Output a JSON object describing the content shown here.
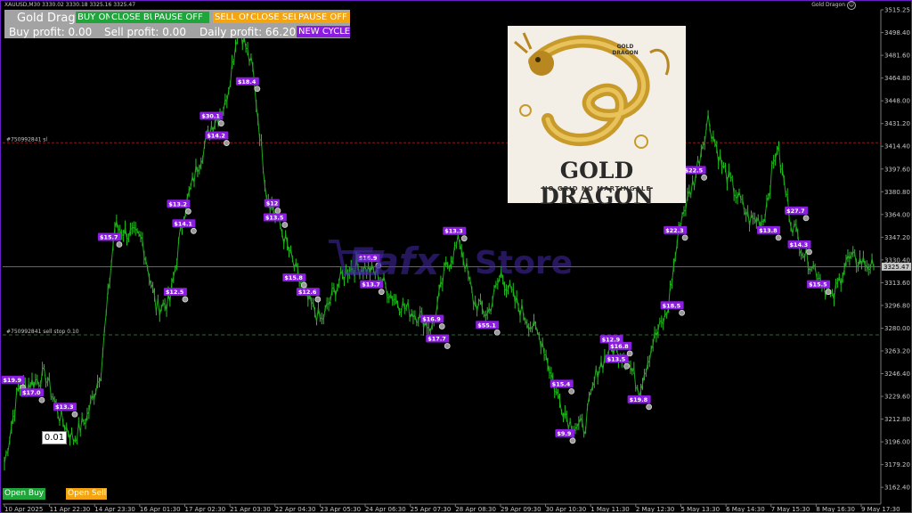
{
  "window": {
    "symbol_info": "XAUUSD,M30  3330.02 3330.18 3325.16 3325.47",
    "ea_name": "Gold Dragon",
    "smiley": "☺"
  },
  "panel": {
    "title": "Gold Dragon",
    "buy_on": "BUY ON",
    "close_buy": "CLOSE BUY",
    "pause_off_1": "PAUSE OFF",
    "sell_on": "SELL ON",
    "close_sell": "CLOSE SELL",
    "pause_off_2": "PAUSE OFF",
    "buy_profit": "Buy profit: 0.00",
    "sell_profit": "Sell profit: 0.00",
    "daily_profit": "Daily profit: 66.20",
    "new_cycle": "NEW CYCLE"
  },
  "logo": {
    "title": "GOLD DRAGON",
    "subtitle": "NO GRID NO MARTINGALE",
    "corner_text": "GOLD DRAGON"
  },
  "watermark": {
    "brand": "Eafx",
    "suffix": "Store"
  },
  "controls": {
    "open_buy": "Open Buy",
    "open_sell": "Open Sell",
    "lot_value": "0.01"
  },
  "lines": {
    "sl_label": "#750992841 sl",
    "sellstop_label": "#750992841 sell stop 0.10",
    "current_price": "3325.47"
  },
  "colors": {
    "accent": "#8a1de0",
    "candles": "#22c41e",
    "buy": "#1fa53a",
    "sell": "#f2a413",
    "border": "#6a1fc4"
  },
  "chart_data": {
    "type": "line",
    "symbol": "XAUUSD",
    "timeframe": "M30",
    "y_ticks": [
      "3515.25",
      "3498.40",
      "3481.60",
      "3464.80",
      "3448.00",
      "3431.20",
      "3414.40",
      "3397.60",
      "3380.80",
      "3364.00",
      "3347.20",
      "3330.40",
      "3313.60",
      "3296.80",
      "3280.00",
      "3263.20",
      "3246.40",
      "3229.60",
      "3212.80",
      "3196.00",
      "3179.20",
      "3162.40"
    ],
    "ylim": [
      3150,
      3515.25
    ],
    "x_ticks": [
      "10 Apr 2025",
      "11 Apr 22:30",
      "14 Apr 23:30",
      "16 Apr 01:30",
      "17 Apr 02:30",
      "21 Apr 03:30",
      "22 Apr 04:30",
      "23 Apr 05:30",
      "24 Apr 06:30",
      "25 Apr 07:30",
      "28 Apr 08:30",
      "29 Apr 09:30",
      "30 Apr 10:30",
      "1 May 11:30",
      "2 May 12:30",
      "5 May 13:30",
      "6 May 14:30",
      "7 May 15:30",
      "8 May 16:30",
      "9 May 17:30"
    ],
    "price_path": [
      3180,
      3235,
      3240,
      3245,
      3215,
      3198,
      3215,
      3250,
      3355,
      3350,
      3345,
      3295,
      3300,
      3365,
      3400,
      3430,
      3445,
      3505,
      3470,
      3380,
      3355,
      3325,
      3300,
      3285,
      3310,
      3325,
      3325,
      3320,
      3305,
      3295,
      3290,
      3280,
      3325,
      3345,
      3300,
      3290,
      3320,
      3300,
      3285,
      3270,
      3232,
      3210,
      3206,
      3250,
      3265,
      3260,
      3235,
      3270,
      3290,
      3360,
      3390,
      3435,
      3400,
      3380,
      3360,
      3360,
      3415,
      3360,
      3335,
      3320,
      3300,
      3330,
      3330,
      3325
    ],
    "trade_labels": [
      "$19.9",
      "$17.0",
      "$13.3",
      "$15.7",
      "$30.1",
      "$14.2",
      "$13.2",
      "$14.1",
      "$12.5",
      "$18.4",
      "$12.6",
      "$12",
      "$13.5",
      "$15.8",
      "$16.9",
      "$13.7",
      "$16.9",
      "$17.7",
      "$13.3",
      "$55.1",
      "$15.4",
      "$9.9",
      "$12.9",
      "$13.5",
      "$16.8",
      "$19.8",
      "$18.5",
      "$22.3",
      "$22.5",
      "$13.8",
      "$14.3",
      "$15.5",
      "$27.7"
    ],
    "grid": false
  }
}
